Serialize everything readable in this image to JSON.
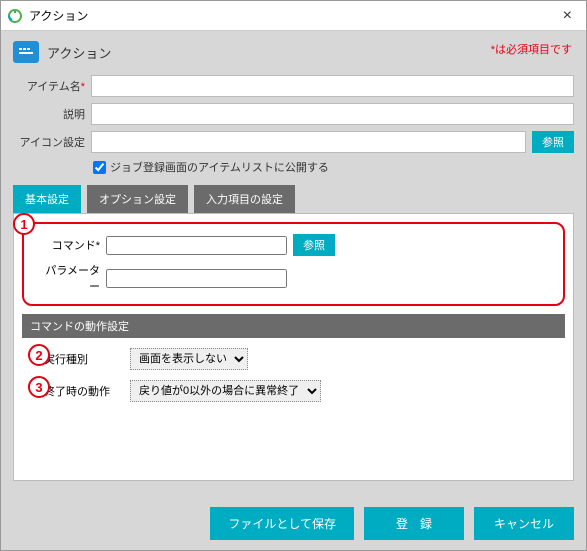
{
  "titlebar": {
    "title": "アクション"
  },
  "header": {
    "title": "アクション"
  },
  "required_note": "*は必須項目です",
  "fields": {
    "item_name": {
      "label": "アイテム名",
      "required": "*",
      "value": ""
    },
    "description": {
      "label": "説明",
      "value": ""
    },
    "icon_setting": {
      "label": "アイコン設定",
      "value": "",
      "browse": "参照"
    }
  },
  "checkbox": {
    "label": "ジョブ登録画面のアイテムリストに公開する",
    "checked": true
  },
  "tabs": [
    {
      "label": "基本設定",
      "active": true
    },
    {
      "label": "オプション設定",
      "active": false
    },
    {
      "label": "入力項目の設定",
      "active": false
    }
  ],
  "basic": {
    "command": {
      "label": "コマンド",
      "required": "*",
      "value": "",
      "browse": "参照"
    },
    "parameter": {
      "label": "パラメーター",
      "value": ""
    },
    "section": "コマンドの動作設定",
    "exec_type": {
      "label": "実行種別",
      "value": "画面を表示しない"
    },
    "end_action": {
      "label": "終了時の動作",
      "value": "戻り値が0以外の場合に異常終了"
    }
  },
  "annotations": {
    "n1": "1",
    "n2": "2",
    "n3": "3"
  },
  "footer": {
    "save_as_file": "ファイルとして保存",
    "register": "登　録",
    "cancel": "キャンセル"
  }
}
